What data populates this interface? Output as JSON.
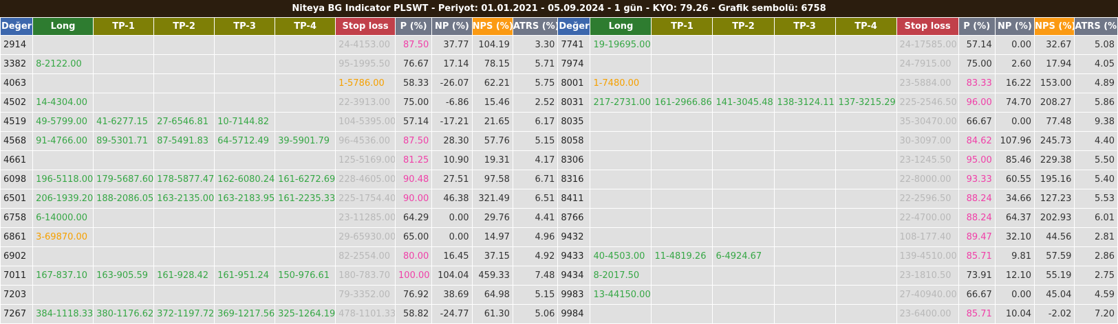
{
  "title": "Niteya BG Indicator PLSWT - Periyot: 01.01.2021 - 05.09.2024 - 1 gün - KYO: 79.26 - Grafik sembolü: 6758",
  "headers": [
    "Değer",
    "Long",
    "TP-1",
    "TP-2",
    "TP-3",
    "TP-4",
    "Stop loss",
    "P (%)",
    "NP (%)",
    "NPS (%)",
    "ATRS (%)"
  ],
  "colors": {
    "header_deger": "#3c67ad",
    "header_long": "#2e7c30",
    "header_tp": "#7e7f06",
    "header_stop_loss": "#c1404a",
    "header_gray": "#707788",
    "header_nps": "#fb9a13",
    "title_bg": "#2b1d0e",
    "cell_bg": "#e0e0e0",
    "green_text": "#36a745",
    "orange_text": "#f5a000",
    "pink_text": "#f040a8",
    "faded_text": "#b8b8b8"
  },
  "left_rows": [
    {
      "deger": "2914",
      "long": "",
      "tp1": "",
      "tp2": "",
      "tp3": "",
      "tp4": "",
      "sl": "24-4153.00",
      "p": "87.50",
      "np": "37.77",
      "nps": "104.19",
      "atrs": "3.30",
      "p_pink": true
    },
    {
      "deger": "3382",
      "long": "8-2122.00",
      "tp1": "",
      "tp2": "",
      "tp3": "",
      "tp4": "",
      "sl": "95-1995.50",
      "p": "76.67",
      "np": "17.14",
      "nps": "78.15",
      "atrs": "5.71"
    },
    {
      "deger": "4063",
      "long": "",
      "tp1": "",
      "tp2": "",
      "tp3": "",
      "tp4": "",
      "sl": "1-5786.00",
      "p": "58.33",
      "np": "-26.07",
      "nps": "62.21",
      "atrs": "5.75",
      "sl_orange": true
    },
    {
      "deger": "4502",
      "long": "14-4304.00",
      "tp1": "",
      "tp2": "",
      "tp3": "",
      "tp4": "",
      "sl": "22-3913.00",
      "p": "75.00",
      "np": "-6.86",
      "nps": "15.46",
      "atrs": "2.52"
    },
    {
      "deger": "4519",
      "long": "49-5799.00",
      "tp1": "41-6277.15",
      "tp2": "27-6546.81",
      "tp3": "10-7144.82",
      "tp4": "",
      "sl": "104-5395.00",
      "p": "57.14",
      "np": "-17.21",
      "nps": "21.65",
      "atrs": "6.17"
    },
    {
      "deger": "4568",
      "long": "91-4766.00",
      "tp1": "89-5301.71",
      "tp2": "87-5491.83",
      "tp3": "64-5712.49",
      "tp4": "39-5901.79",
      "sl": "96-4536.00",
      "p": "87.50",
      "np": "28.30",
      "nps": "57.76",
      "atrs": "5.15",
      "p_pink": true
    },
    {
      "deger": "4661",
      "long": "",
      "tp1": "",
      "tp2": "",
      "tp3": "",
      "tp4": "",
      "sl": "125-5169.00",
      "p": "81.25",
      "np": "10.90",
      "nps": "19.31",
      "atrs": "4.17",
      "p_pink": true
    },
    {
      "deger": "6098",
      "long": "196-5118.00",
      "tp1": "179-5687.60",
      "tp2": "178-5877.47",
      "tp3": "162-6080.24",
      "tp4": "161-6272.69",
      "sl": "228-4605.00",
      "p": "90.48",
      "np": "27.51",
      "nps": "97.58",
      "atrs": "6.71",
      "p_pink": true
    },
    {
      "deger": "6501",
      "long": "206-1939.20",
      "tp1": "188-2086.05",
      "tp2": "163-2135.00",
      "tp3": "163-2183.95",
      "tp4": "161-2235.33",
      "sl": "225-1754.40",
      "p": "90.00",
      "np": "46.38",
      "nps": "321.49",
      "atrs": "6.51",
      "p_pink": true
    },
    {
      "deger": "6758",
      "long": "6-14000.00",
      "tp1": "",
      "tp2": "",
      "tp3": "",
      "tp4": "",
      "sl": "23-11285.00",
      "p": "64.29",
      "np": "0.00",
      "nps": "29.76",
      "atrs": "4.41"
    },
    {
      "deger": "6861",
      "long": "3-69870.00",
      "tp1": "",
      "tp2": "",
      "tp3": "",
      "tp4": "",
      "sl": "29-65930.00",
      "p": "65.00",
      "np": "0.00",
      "nps": "14.97",
      "atrs": "4.96",
      "long_orange": true
    },
    {
      "deger": "6902",
      "long": "",
      "tp1": "",
      "tp2": "",
      "tp3": "",
      "tp4": "",
      "sl": "82-2554.00",
      "p": "80.00",
      "np": "16.45",
      "nps": "37.15",
      "atrs": "4.92",
      "p_pink": true
    },
    {
      "deger": "7011",
      "long": "167-837.10",
      "tp1": "163-905.59",
      "tp2": "161-928.42",
      "tp3": "161-951.24",
      "tp4": "150-976.61",
      "sl": "180-783.70",
      "p": "100.00",
      "np": "104.04",
      "nps": "459.33",
      "atrs": "7.48",
      "p_pink": true
    },
    {
      "deger": "7203",
      "long": "",
      "tp1": "",
      "tp2": "",
      "tp3": "",
      "tp4": "",
      "sl": "79-3352.00",
      "p": "76.92",
      "np": "38.69",
      "nps": "64.98",
      "atrs": "5.15"
    },
    {
      "deger": "7267",
      "long": "384-1118.33",
      "tp1": "380-1176.62",
      "tp2": "372-1197.72",
      "tp3": "369-1217.56",
      "tp4": "325-1264.19",
      "sl": "478-1101.33",
      "p": "58.82",
      "np": "-24.77",
      "nps": "61.30",
      "atrs": "5.06"
    }
  ],
  "right_rows": [
    {
      "deger": "7741",
      "long": "19-19695.00",
      "tp1": "",
      "tp2": "",
      "tp3": "",
      "tp4": "",
      "sl": "24-17585.00",
      "p": "57.14",
      "np": "0.00",
      "nps": "32.67",
      "atrs": "5.08"
    },
    {
      "deger": "7974",
      "long": "",
      "tp1": "",
      "tp2": "",
      "tp3": "",
      "tp4": "",
      "sl": "24-7915.00",
      "p": "75.00",
      "np": "2.60",
      "nps": "17.94",
      "atrs": "4.05"
    },
    {
      "deger": "8001",
      "long": "1-7480.00",
      "tp1": "",
      "tp2": "",
      "tp3": "",
      "tp4": "",
      "sl": "23-5884.00",
      "p": "83.33",
      "np": "16.22",
      "nps": "153.00",
      "atrs": "4.89",
      "long_orange": true,
      "p_pink": true
    },
    {
      "deger": "8031",
      "long": "217-2731.00",
      "tp1": "161-2966.86",
      "tp2": "141-3045.48",
      "tp3": "138-3124.11",
      "tp4": "137-3215.29",
      "sl": "225-2546.50",
      "p": "96.00",
      "np": "74.70",
      "nps": "208.27",
      "atrs": "5.86",
      "p_pink": true
    },
    {
      "deger": "8035",
      "long": "",
      "tp1": "",
      "tp2": "",
      "tp3": "",
      "tp4": "",
      "sl": "35-30470.00",
      "p": "66.67",
      "np": "0.00",
      "nps": "77.48",
      "atrs": "9.38"
    },
    {
      "deger": "8058",
      "long": "",
      "tp1": "",
      "tp2": "",
      "tp3": "",
      "tp4": "",
      "sl": "30-3097.00",
      "p": "84.62",
      "np": "107.96",
      "nps": "245.73",
      "atrs": "4.40",
      "p_pink": true
    },
    {
      "deger": "8306",
      "long": "",
      "tp1": "",
      "tp2": "",
      "tp3": "",
      "tp4": "",
      "sl": "23-1245.50",
      "p": "95.00",
      "np": "85.46",
      "nps": "229.38",
      "atrs": "5.50",
      "p_pink": true
    },
    {
      "deger": "8316",
      "long": "",
      "tp1": "",
      "tp2": "",
      "tp3": "",
      "tp4": "",
      "sl": "22-8000.00",
      "p": "93.33",
      "np": "60.55",
      "nps": "195.16",
      "atrs": "5.40",
      "p_pink": true
    },
    {
      "deger": "8411",
      "long": "",
      "tp1": "",
      "tp2": "",
      "tp3": "",
      "tp4": "",
      "sl": "22-2596.50",
      "p": "88.24",
      "np": "34.66",
      "nps": "127.23",
      "atrs": "5.53",
      "p_pink": true
    },
    {
      "deger": "8766",
      "long": "",
      "tp1": "",
      "tp2": "",
      "tp3": "",
      "tp4": "",
      "sl": "22-4700.00",
      "p": "88.24",
      "np": "64.37",
      "nps": "202.93",
      "atrs": "6.01",
      "p_pink": true
    },
    {
      "deger": "9432",
      "long": "",
      "tp1": "",
      "tp2": "",
      "tp3": "",
      "tp4": "",
      "sl": "108-177.40",
      "p": "89.47",
      "np": "32.10",
      "nps": "44.56",
      "atrs": "2.81",
      "p_pink": true
    },
    {
      "deger": "9433",
      "long": "40-4503.00",
      "tp1": "11-4819.26",
      "tp2": "6-4924.67",
      "tp3": "",
      "tp4": "",
      "sl": "139-4510.00",
      "p": "85.71",
      "np": "9.81",
      "nps": "57.59",
      "atrs": "2.86",
      "p_pink": true
    },
    {
      "deger": "9434",
      "long": "8-2017.50",
      "tp1": "",
      "tp2": "",
      "tp3": "",
      "tp4": "",
      "sl": "23-1810.50",
      "p": "73.91",
      "np": "12.10",
      "nps": "55.19",
      "atrs": "2.75"
    },
    {
      "deger": "9983",
      "long": "13-44150.00",
      "tp1": "",
      "tp2": "",
      "tp3": "",
      "tp4": "",
      "sl": "27-40940.00",
      "p": "66.67",
      "np": "0.00",
      "nps": "45.04",
      "atrs": "4.59"
    },
    {
      "deger": "9984",
      "long": "",
      "tp1": "",
      "tp2": "",
      "tp3": "",
      "tp4": "",
      "sl": "23-6400.00",
      "p": "85.71",
      "np": "10.04",
      "nps": "-2.02",
      "atrs": "7.20",
      "p_pink": true
    }
  ]
}
